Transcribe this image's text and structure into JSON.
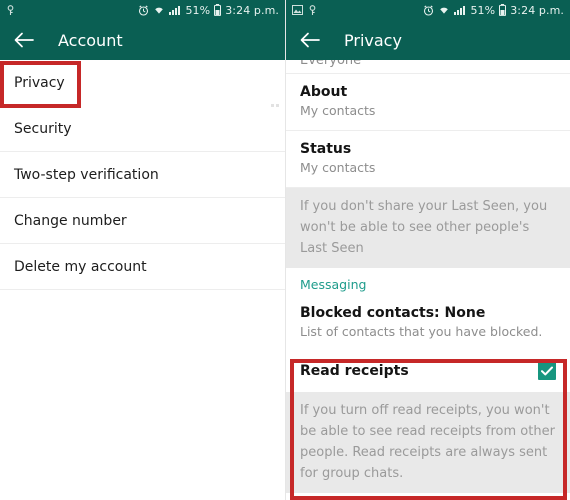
{
  "statusbar": {
    "time": "3:24 p.m.",
    "battery_percent": "51%",
    "icons": {
      "image": "image-icon",
      "key": "key-icon",
      "alarm": "alarm-icon",
      "wifi": "wifi-icon",
      "signal": "signal-icon",
      "battery": "battery-icon"
    }
  },
  "left_screen": {
    "appbar": {
      "title": "Account",
      "back_label": "back-arrow"
    },
    "rows": [
      {
        "label": "Privacy",
        "highlighted": true
      },
      {
        "label": "Security",
        "highlighted": false
      },
      {
        "label": "Two-step verification",
        "highlighted": false
      },
      {
        "label": "Change number",
        "highlighted": false
      },
      {
        "label": "Delete my account",
        "highlighted": false
      }
    ]
  },
  "right_screen": {
    "appbar": {
      "title": "Privacy",
      "back_label": "back-arrow"
    },
    "cut_row_label": "Everyone",
    "prefs": [
      {
        "title": "About",
        "subtitle": "My contacts"
      },
      {
        "title": "Status",
        "subtitle": "My contacts"
      }
    ],
    "info_last_seen": "If you don't share your Last Seen, you won't be able to see other people's Last Seen",
    "section_messaging": "Messaging",
    "blocked": {
      "title": "Blocked contacts: None",
      "subtitle": "List of contacts that you have blocked."
    },
    "read_receipts": {
      "label": "Read receipts",
      "checked": true,
      "info": "If you turn off read receipts, you won't be able to see read receipts from other people. Read receipts are always sent for group chats."
    }
  },
  "colors": {
    "appbar": "#0a5f53",
    "accent_teal": "#1f9c8c",
    "checkbox": "#17967f",
    "highlight_red": "#c62828",
    "info_bg": "#e9e9e9"
  }
}
